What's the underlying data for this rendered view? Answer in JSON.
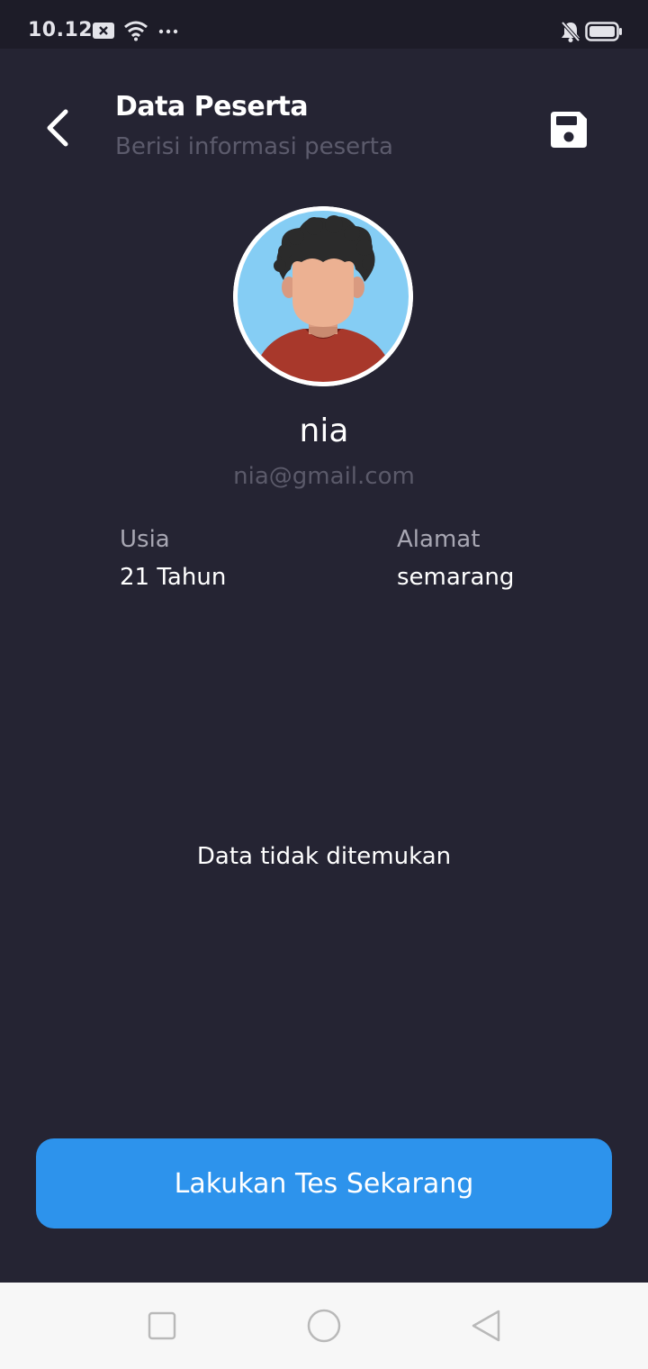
{
  "status_bar": {
    "time": "10.12",
    "icons": [
      "notification-x-icon",
      "wifi-icon",
      "more-dots-icon",
      "silent-bell-icon",
      "battery-icon"
    ]
  },
  "header": {
    "title": "Data Peserta",
    "subtitle": "Berisi informasi peserta",
    "back_icon": "chevron-left-icon",
    "save_icon": "save-floppy-icon"
  },
  "profile": {
    "avatar_icon": "avatar-illustration",
    "name": "nia",
    "email": "nia@gmail.com"
  },
  "info": {
    "age_label": "Usia",
    "age_value": "21 Tahun",
    "address_label": "Alamat",
    "address_value": "semarang"
  },
  "empty_state": {
    "message": "Data tidak ditemukan"
  },
  "cta": {
    "label": "Lakukan Tes Sekarang"
  },
  "colors": {
    "background": "#252433",
    "status_bar": "#1d1c28",
    "button": "#2d93ec",
    "muted_text": "#5c5b6c",
    "label_text": "#a8a7b3",
    "nav_bar": "#f7f7f7"
  },
  "nav_bar": {
    "icons": [
      "recents-square-icon",
      "home-circle-icon",
      "back-triangle-icon"
    ]
  }
}
